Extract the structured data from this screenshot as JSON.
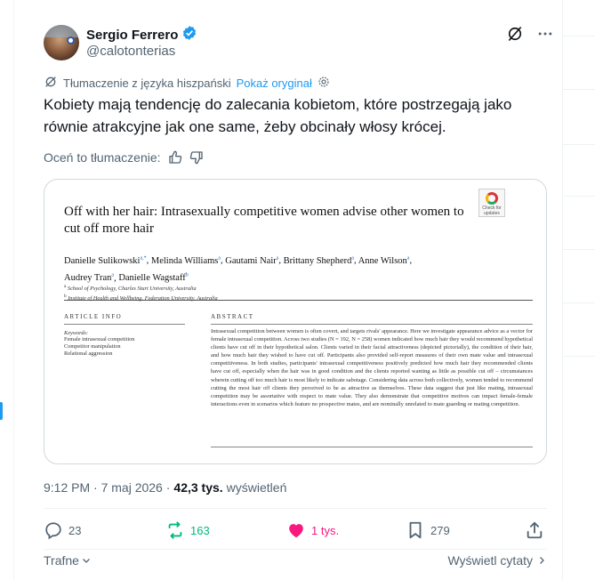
{
  "tweet": {
    "author_name": "Sergio Ferrero",
    "author_handle": "@calotonterias",
    "translated_from": "Tłumaczenie z języka hiszpański",
    "show_original": "Pokaż oryginał",
    "text": "Kobiety mają tendencję do zalecania kobietom, które postrzegają jako równie atrakcyjne jak one same, żeby obcinały włosy krócej.",
    "rate_translation": "Oceń to tłumaczenie:",
    "time": "9:12 PM · 7 maj 2026 ·",
    "views_count": "42,3 tys.",
    "views_label": "wyświetleń",
    "replies": "23",
    "reposts": "163",
    "likes": "1 tys.",
    "bookmarks": "279",
    "sort_label": "Trafne",
    "view_quotes": "Wyświetl cytaty"
  },
  "paper": {
    "title": "Off with her hair: Intrasexually competitive women advise other women to cut off more hair",
    "check_badge": "Check for updates",
    "authors_line1": [
      {
        "name": "Danielle Sulikowski",
        "sup": "a,*"
      },
      {
        "name": "Melinda Williams",
        "sup": "a"
      },
      {
        "name": "Gautami Nair",
        "sup": "a"
      },
      {
        "name": "Brittany Shepherd",
        "sup": "a"
      },
      {
        "name": "Anne Wilson",
        "sup": "a"
      }
    ],
    "authors_line2": [
      {
        "name": "Audrey Tran",
        "sup": "a"
      },
      {
        "name": "Danielle Wagstaff",
        "sup": "b"
      }
    ],
    "affil_a_sup": "a",
    "affil_a": "School of Psychology, Charles Sturt University, Australia",
    "affil_b_sup": "b",
    "affil_b": "Institute of Health and Wellbeing, Federation University, Australia",
    "article_info_head": "ARTICLE INFO",
    "abstract_head": "ABSTRACT",
    "keywords_head": "Keywords:",
    "keywords": [
      "Female intrasexual competition",
      "Competitor manipulation",
      "Relational aggression"
    ],
    "abstract": "Intrasexual competition between women is often covert, and targets rivals' appearance. Here we investigate appearance advice as a vector for female intrasexual competition. Across two studies (N = 192, N = 258) women indicated how much hair they would recommend hypothetical clients have cut off in their hypothetical salon. Clients varied in their facial attractiveness (depicted pictorially), the condition of their hair, and how much hair they wished to have cut off. Participants also provided self-report measures of their own mate value and intrasexual competitiveness. In both studies, participants' intrasexual competitiveness positively predicted how much hair they recommended clients have cut off, especially when the hair was in good condition and the clients reported wanting as little as possible cut off – circumstances wherein cutting off too much hair is most likely to indicate sabotage. Considering data across both collectively, women tended to recommend cutting the most hair off clients they perceived to be as attractive as themselves. These data suggest that just like mating, intrasexual competition may be assortative with respect to mate value. They also demonstrate that competitive motives can impact female-female interactions even in scenarios which feature no prospective mates, and are nominally unrelated to mate guarding or mating competition."
  },
  "colors": {
    "accent": "#1d9bf0",
    "text_secondary": "#536471",
    "repost_green": "#00ba7c",
    "like_pink": "#f91880"
  }
}
